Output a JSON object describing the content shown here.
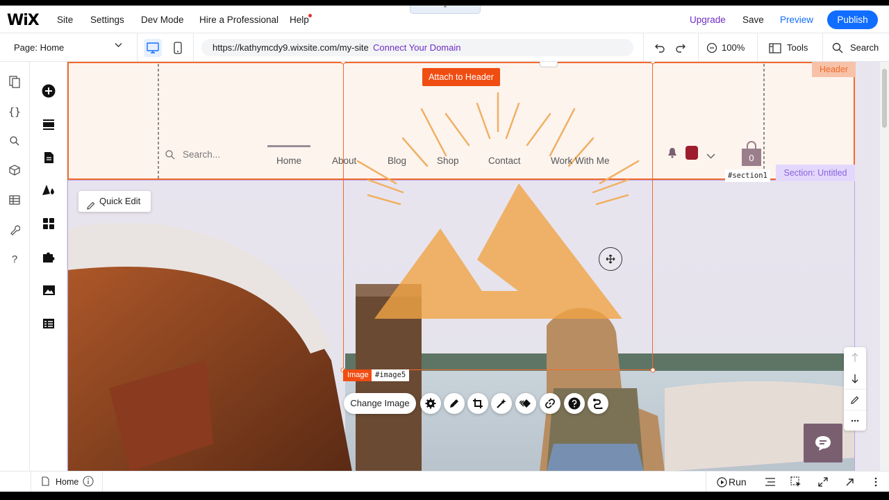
{
  "topbar": {
    "logo": "WiX",
    "nav": [
      "Site",
      "Settings",
      "Dev Mode",
      "Hire a Professional",
      "Help"
    ],
    "collapse_glyph": "⌃",
    "upgrade": "Upgrade",
    "save": "Save",
    "preview": "Preview",
    "publish": "Publish"
  },
  "toolbar": {
    "page_selector": "Page: Home",
    "url": "https://kathymcdy9.wixsite.com/my-site",
    "connect_domain": "Connect Your Domain",
    "zoom": "100%",
    "tools": "Tools",
    "search": "Search"
  },
  "site_header": {
    "search_placeholder": "Search...",
    "menu": [
      "Home",
      "About",
      "Blog",
      "Shop",
      "Contact",
      "Work With Me"
    ],
    "cart_count": "0"
  },
  "editor_labels": {
    "attach_to_header": "Attach to Header",
    "header_tag": "Header",
    "section_tag": "Section: Untitled",
    "section_id": "#section1",
    "quick_edit": "Quick Edit",
    "image_tag": "Image",
    "image_id": "#image5",
    "change_image": "Change Image"
  },
  "bottombar": {
    "page_tab": "Home",
    "run": "Run"
  },
  "colors": {
    "accent_blue": "#116dff",
    "upgrade_purple": "#6e2ec4",
    "header_orange": "#f26a2b",
    "section_purple": "#8a62e0",
    "logo_sun": "#f0b064",
    "chat_button": "#7a5f71"
  },
  "icons": {
    "left_rail": [
      "pages-icon",
      "code-icon",
      "search-icon",
      "cube-icon",
      "table-icon",
      "wrench-icon",
      "help-icon"
    ],
    "add_panel": [
      "add-icon",
      "sections-icon",
      "page-icon",
      "theme-icon",
      "apps-icon",
      "puzzle-icon",
      "media-icon",
      "cms-icon"
    ],
    "image_toolbar": [
      "settings-icon",
      "pen-icon",
      "crop-icon",
      "magic-icon",
      "animation-icon",
      "link-icon",
      "help-icon",
      "connect-icon"
    ]
  }
}
